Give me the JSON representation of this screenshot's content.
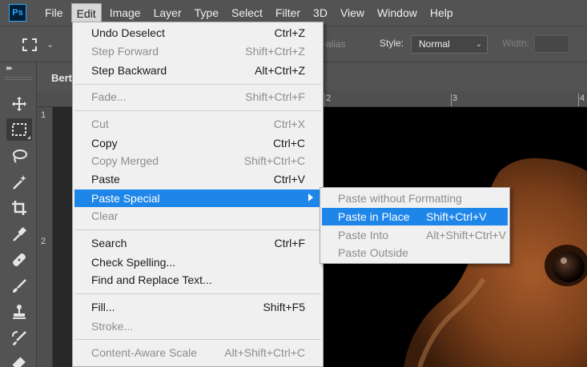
{
  "menubar": {
    "logo": "Ps",
    "items": [
      "File",
      "Edit",
      "Image",
      "Layer",
      "Type",
      "Select",
      "Filter",
      "3D",
      "View",
      "Window",
      "Help"
    ],
    "active": "Edit"
  },
  "options": {
    "antialias_label": "ti-alias",
    "style_label": "Style:",
    "style_value": "Normal",
    "width_label": "Width:"
  },
  "doc": {
    "tab_title": "Bert",
    "ruler_top": [
      "2",
      "3",
      "4"
    ],
    "ruler_left": [
      "1",
      "2"
    ]
  },
  "edit_menu": [
    {
      "label": "Undo Deselect",
      "shortcut": "Ctrl+Z",
      "enabled": true
    },
    {
      "label": "Step Forward",
      "shortcut": "Shift+Ctrl+Z",
      "enabled": false
    },
    {
      "label": "Step Backward",
      "shortcut": "Alt+Ctrl+Z",
      "enabled": true
    },
    {
      "label": "Fade...",
      "shortcut": "Shift+Ctrl+F",
      "enabled": false
    },
    {
      "label": "Cut",
      "shortcut": "Ctrl+X",
      "enabled": false
    },
    {
      "label": "Copy",
      "shortcut": "Ctrl+C",
      "enabled": true
    },
    {
      "label": "Copy Merged",
      "shortcut": "Shift+Ctrl+C",
      "enabled": false
    },
    {
      "label": "Paste",
      "shortcut": "Ctrl+V",
      "enabled": true
    },
    {
      "label": "Paste Special",
      "shortcut": "",
      "enabled": true,
      "highlighted": true,
      "submenu": true
    },
    {
      "label": "Clear",
      "shortcut": "",
      "enabled": false
    },
    {
      "label": "Search",
      "shortcut": "Ctrl+F",
      "enabled": true
    },
    {
      "label": "Check Spelling...",
      "shortcut": "",
      "enabled": true
    },
    {
      "label": "Find and Replace Text...",
      "shortcut": "",
      "enabled": true
    },
    {
      "label": "Fill...",
      "shortcut": "Shift+F5",
      "enabled": true
    },
    {
      "label": "Stroke...",
      "shortcut": "",
      "enabled": false
    },
    {
      "label": "Content-Aware Scale",
      "shortcut": "Alt+Shift+Ctrl+C",
      "enabled": false
    }
  ],
  "paste_special_menu": [
    {
      "label": "Paste without Formatting",
      "shortcut": "",
      "enabled": false
    },
    {
      "label": "Paste in Place",
      "shortcut": "Shift+Ctrl+V",
      "enabled": true,
      "highlighted": true
    },
    {
      "label": "Paste Into",
      "shortcut": "Alt+Shift+Ctrl+V",
      "enabled": false
    },
    {
      "label": "Paste Outside",
      "shortcut": "",
      "enabled": false
    }
  ],
  "tools": [
    "move-tool",
    "rectangular-marquee-tool",
    "lasso-tool",
    "magic-wand-tool",
    "crop-tool",
    "eyedropper-tool",
    "healing-brush-tool",
    "brush-tool",
    "clone-stamp-tool",
    "history-brush-tool",
    "eraser-tool"
  ],
  "colors": {
    "ui_dark": "#535353",
    "menu_bg": "#f0f0f0",
    "highlight": "#1e86e8",
    "disabled_text": "#8d8d8d"
  }
}
